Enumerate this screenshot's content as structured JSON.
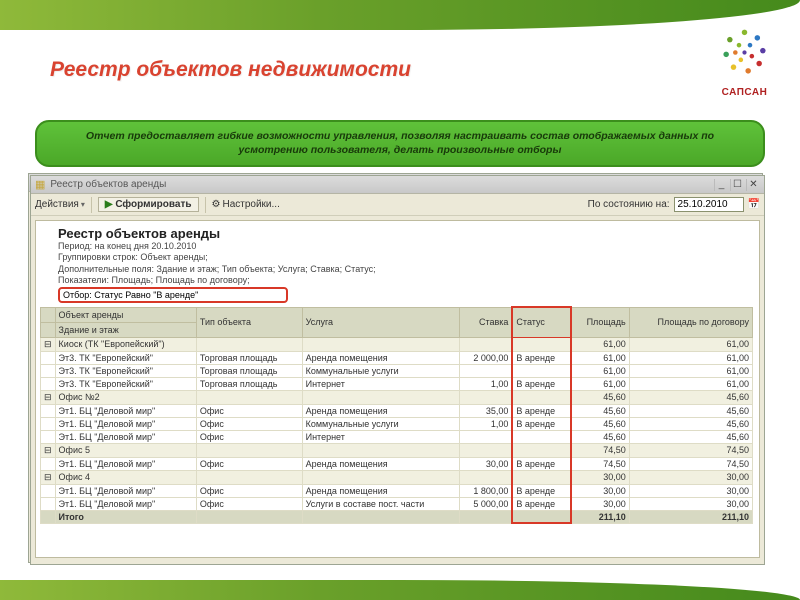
{
  "brand": {
    "name": "САПСАН"
  },
  "slide": {
    "title": "Реестр объектов недвижимости"
  },
  "description": {
    "text": "Отчет предоставляет гибкие возможности управления, позволяя настраивать состав отображаемых данных по усмотрению пользователя, делать произвольные отборы"
  },
  "window": {
    "title": "Реестр объектов аренды",
    "back_title": "Реестр объектов аренды"
  },
  "toolbar": {
    "actions": "Действия",
    "form": "Сформировать",
    "settings": "Настройки...",
    "date_label": "По состоянию на:",
    "date_value": "25.10.2010"
  },
  "report": {
    "title": "Реестр объектов аренды",
    "period": "Период: на конец дня 20.10.2010",
    "grouping": "Группировки строк: Объект аренды;",
    "additional": "Дополнительные поля: Здание и этаж; Тип объекта; Услуга; Ставка; Статус;",
    "indicators": "Показатели: Площадь; Площадь по договору;",
    "filter": "Отбор: Статус Равно \"В аренде\""
  },
  "columns": {
    "c0": "Объект аренды",
    "c1": "Здание и этаж",
    "c2": "Тип объекта",
    "c3": "Услуга",
    "c4": "Ставка",
    "c5": "Статус",
    "c6": "Площадь",
    "c7": "Площадь по договору"
  },
  "rows": [
    {
      "group": true,
      "label": "Киоск (ТК \"Европейский\")",
      "area": "61,00",
      "area_c": "61,00"
    },
    {
      "label": "Эт3. ТК \"Европейский\"",
      "type": "Торговая площадь",
      "service": "Аренда помещения",
      "rate": "2 000,00",
      "status": "В аренде",
      "area": "61,00",
      "area_c": "61,00"
    },
    {
      "label": "Эт3. ТК \"Европейский\"",
      "type": "Торговая площадь",
      "service": "Коммунальные услуги",
      "area": "61,00",
      "area_c": "61,00"
    },
    {
      "label": "Эт3. ТК \"Европейский\"",
      "type": "Торговая площадь",
      "service": "Интернет",
      "rate": "1,00",
      "status": "В аренде",
      "area": "61,00",
      "area_c": "61,00"
    },
    {
      "group": true,
      "label": "Офис №2",
      "area": "45,60",
      "area_c": "45,60"
    },
    {
      "label": "Эт1. БЦ \"Деловой мир\"",
      "type": "Офис",
      "service": "Аренда помещения",
      "rate": "35,00",
      "status": "В аренде",
      "area": "45,60",
      "area_c": "45,60"
    },
    {
      "label": "Эт1. БЦ \"Деловой мир\"",
      "type": "Офис",
      "service": "Коммунальные услуги",
      "rate": "1,00",
      "status": "В аренде",
      "area": "45,60",
      "area_c": "45,60"
    },
    {
      "label": "Эт1. БЦ \"Деловой мир\"",
      "type": "Офис",
      "service": "Интернет",
      "area": "45,60",
      "area_c": "45,60"
    },
    {
      "group": true,
      "label": "Офис 5",
      "area": "74,50",
      "area_c": "74,50"
    },
    {
      "label": "Эт1. БЦ \"Деловой мир\"",
      "type": "Офис",
      "service": "Аренда помещения",
      "rate": "30,00",
      "status": "В аренде",
      "area": "74,50",
      "area_c": "74,50"
    },
    {
      "group": true,
      "label": "Офис 4",
      "area": "30,00",
      "area_c": "30,00"
    },
    {
      "label": "Эт1. БЦ \"Деловой мир\"",
      "type": "Офис",
      "service": "Аренда помещения",
      "rate": "1 800,00",
      "status": "В аренде",
      "area": "30,00",
      "area_c": "30,00"
    },
    {
      "label": "Эт1. БЦ \"Деловой мир\"",
      "type": "Офис",
      "service": "Услуги в составе пост. части",
      "rate": "5 000,00",
      "status": "В аренде",
      "area": "30,00",
      "area_c": "30,00"
    }
  ],
  "totals": {
    "label": "Итого",
    "area": "211,10",
    "area_c": "211,10"
  }
}
